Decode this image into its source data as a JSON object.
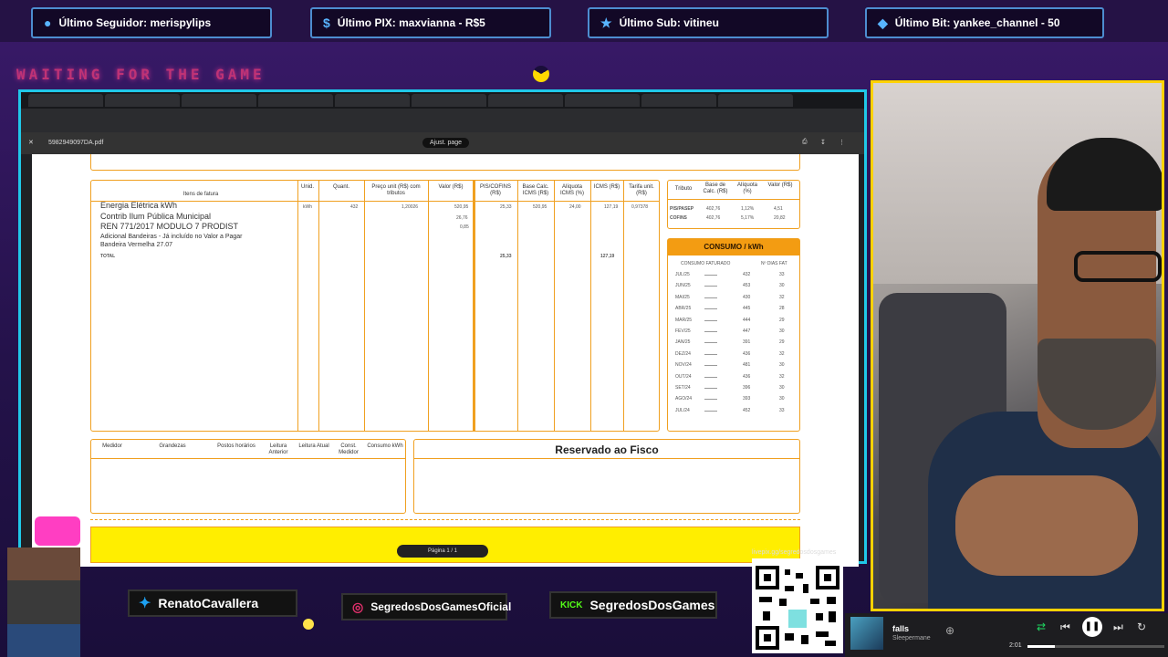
{
  "alerts": {
    "follower": "Último Seguidor: merispylips",
    "pix": "Último PIX: maxvianna - R$5",
    "sub": "Último Sub: vitineu",
    "bit": "Último Bit: yankee_channel - 50"
  },
  "waiting_text": "WAITING FOR THE GAME",
  "browser": {
    "pdf_filename": "5982949097DA.pdf",
    "zoom": "Ajust. page"
  },
  "invoice": {
    "headers": [
      "Itens de fatura",
      "Unid.",
      "Quant.",
      "Preço unit (R$) com tributos",
      "Valor (R$)",
      "PIS/COFINS (R$)",
      "Base Calc. ICMS (R$)",
      "Alíquota ICMS (%)",
      "ICMS (R$)",
      "Tarifa unit. (R$)"
    ],
    "items": [
      "Energia Elétrica kWh",
      "Contrib Ilum Pública Municipal",
      "REN 771/2017 MODULO 7 PRODIST",
      "Adicional Bandeiras - Já incluído no Valor a Pagar",
      "Bandeira Vermelha 27.07"
    ],
    "total_label": "TOTAL",
    "row_values": [
      "kWh",
      "432",
      "1,20026",
      "520,95",
      "25,33",
      "520,95",
      "24,00",
      "127,19",
      "0,97378"
    ],
    "extra_values": [
      "26,76",
      "0,85"
    ],
    "totals": {
      "pis": "25,33",
      "icms": "127,19"
    }
  },
  "tributo": {
    "headers": [
      "Tributo",
      "Base de Calc. (R$)",
      "Alíquota (%)",
      "Valor (R$)"
    ],
    "rows": [
      {
        "name": "PIS/PASEP",
        "base": "402,76",
        "rate": "1,12%",
        "value": "4,51"
      },
      {
        "name": "COFINS",
        "base": "402,76",
        "rate": "5,17%",
        "value": "20,82"
      }
    ]
  },
  "consumo": {
    "title": "CONSUMO / kWh",
    "col1": "CONSUMO FATURADO",
    "col2": "Nº DIAS FAT",
    "rows": [
      {
        "m": "JUL/25",
        "v": "432",
        "d": "33"
      },
      {
        "m": "JUN/25",
        "v": "453",
        "d": "30"
      },
      {
        "m": "MAI/25",
        "v": "430",
        "d": "32"
      },
      {
        "m": "ABR/25",
        "v": "445",
        "d": "28"
      },
      {
        "m": "MAR/25",
        "v": "444",
        "d": "29"
      },
      {
        "m": "FEV/25",
        "v": "447",
        "d": "30"
      },
      {
        "m": "JAN/25",
        "v": "391",
        "d": "29"
      },
      {
        "m": "DEZ/24",
        "v": "436",
        "d": "32"
      },
      {
        "m": "NOV/24",
        "v": "481",
        "d": "30"
      },
      {
        "m": "OUT/24",
        "v": "436",
        "d": "32"
      },
      {
        "m": "SET/24",
        "v": "396",
        "d": "30"
      },
      {
        "m": "AGO/24",
        "v": "393",
        "d": "30"
      },
      {
        "m": "JUL/24",
        "v": "452",
        "d": "33"
      }
    ]
  },
  "medidor": {
    "headers": [
      "Medidor",
      "Grandezas",
      "Postos horários",
      "Leitura Anterior",
      "Leitura Atual",
      "Const. Medidor",
      "Consumo kWh"
    ]
  },
  "fisco_title": "Reservado ao Fisco",
  "pager": "Página 1 / 1",
  "socials": {
    "twitter": "RenatoCavallera",
    "instagram": "SegredosDosGamesOficial",
    "kick_logo": "KICK",
    "kick": "SegredosDosGames"
  },
  "qr_label": "livepix.gg/segredosdosgames",
  "music": {
    "title": "falls",
    "artist": "Sleepermane",
    "time": "2:01"
  }
}
